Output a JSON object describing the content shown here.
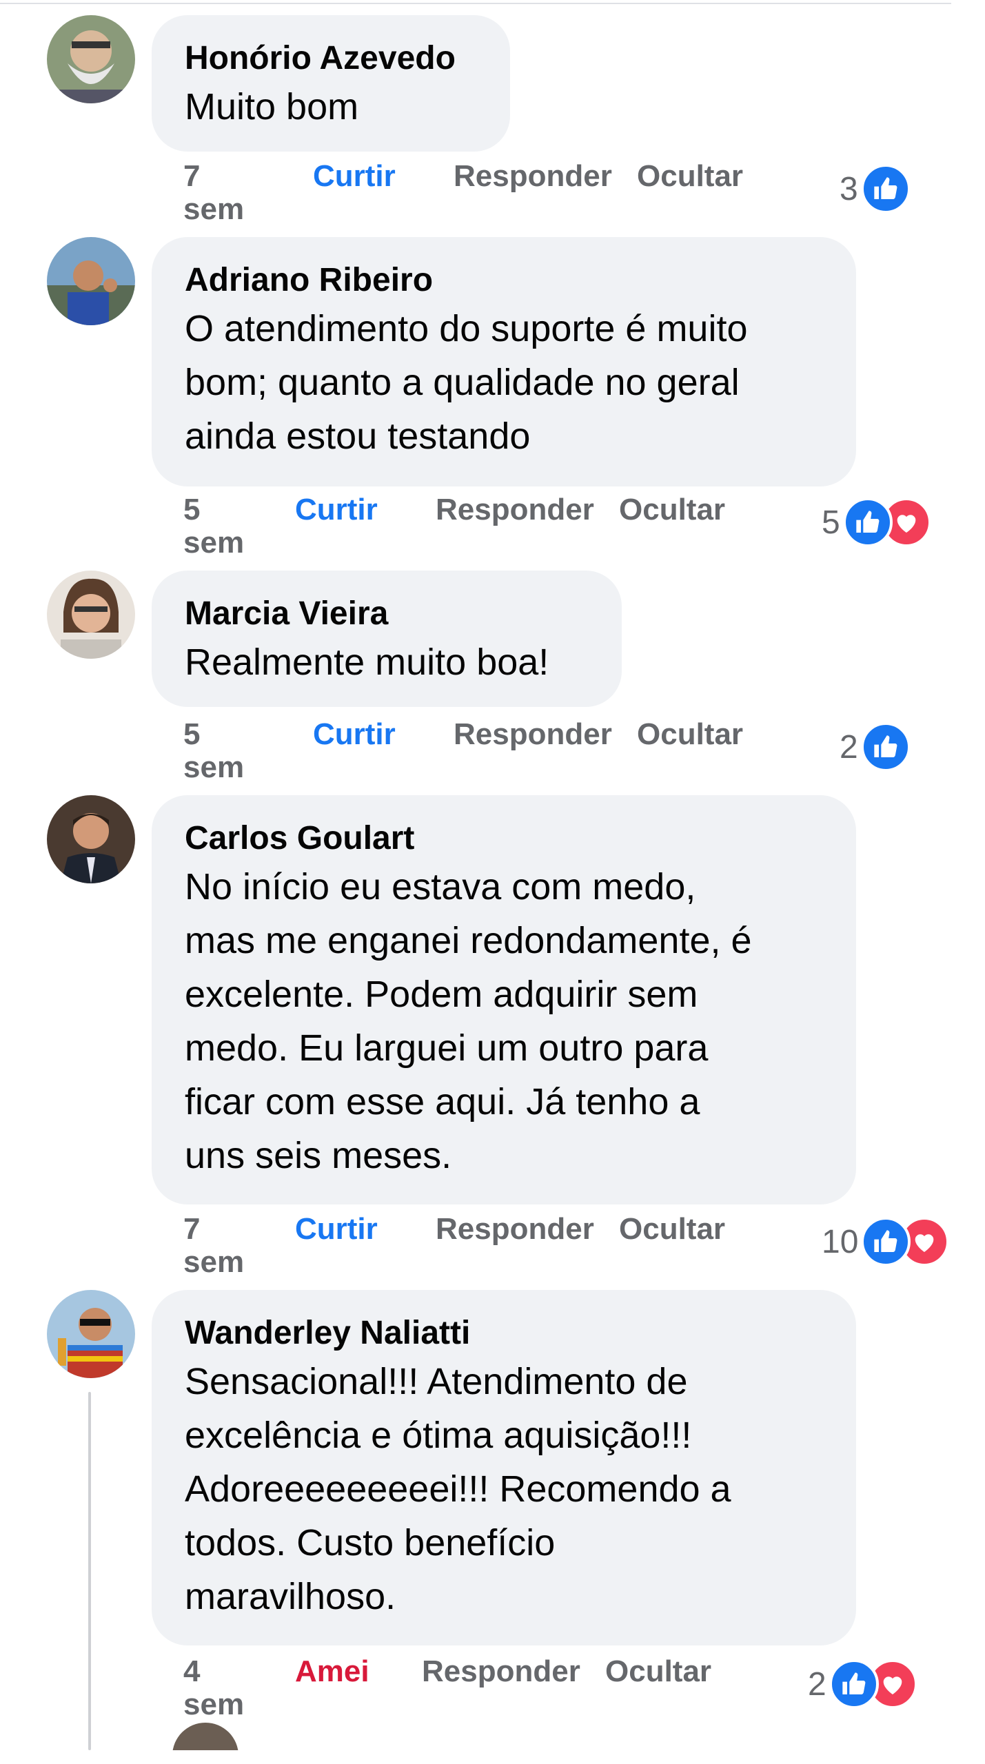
{
  "colors": {
    "bubble": "#f0f2f5",
    "like_blue": "#1877f2",
    "love_red": "#f33e58",
    "amei_red": "#d8193a",
    "meta_gray": "#65676b"
  },
  "actions": {
    "like": "Curtir",
    "love": "Amei",
    "reply": "Responder",
    "hide": "Ocultar"
  },
  "comments": [
    {
      "author": "Honório Azevedo",
      "text": "Muito bom",
      "time_num": "7",
      "time_unit": "sem",
      "reaction_label": "Curtir",
      "reaction_count": "3",
      "reaction_icons": [
        "like-icon"
      ]
    },
    {
      "author": "Adriano Ribeiro",
      "text": "O atendimento do suporte é muito\nbom; quanto a qualidade no geral\nainda estou testando",
      "time_num": "5",
      "time_unit": "sem",
      "reaction_label": "Curtir",
      "reaction_count": "5",
      "reaction_icons": [
        "like-icon",
        "love-icon"
      ]
    },
    {
      "author": "Marcia Vieira",
      "text": "Realmente muito boa!",
      "time_num": "5",
      "time_unit": "sem",
      "reaction_label": "Curtir",
      "reaction_count": "2",
      "reaction_icons": [
        "like-icon"
      ]
    },
    {
      "author": "Carlos Goulart",
      "text": "No início eu estava com medo,\nmas me enganei redondamente, é\nexcelente. Podem adquirir sem\nmedo. Eu larguei um outro para\nficar com esse aqui. Já tenho a\nuns seis meses.",
      "time_num": "7",
      "time_unit": "sem",
      "reaction_label": "Curtir",
      "reaction_count": "10",
      "reaction_icons": [
        "like-icon",
        "love-icon"
      ]
    },
    {
      "author": "Wanderley Naliatti",
      "text": "Sensacional!!! Atendimento de\nexcelência e ótima aquisição!!!\nAdoreeeeeeeeei!!! Recomendo a\ntodos. Custo benefício\nmaravilhoso.",
      "time_num": "4",
      "time_unit": "sem",
      "reaction_label": "Amei",
      "reaction_count": "2",
      "reaction_icons": [
        "like-icon",
        "love-icon"
      ]
    }
  ]
}
